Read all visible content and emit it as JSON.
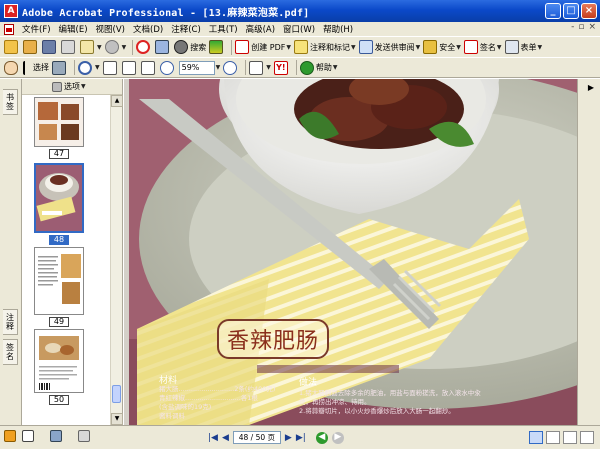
{
  "window": {
    "title": "Adobe Acrobat Professional - [13.麻辣菜泡菜.pdf]",
    "app_icon_letter": "A",
    "controls": {
      "minimize": "_",
      "maximize": "□",
      "close": "×"
    }
  },
  "menubar": {
    "items": [
      "文件(F)",
      "编辑(E)",
      "视图(V)",
      "文档(D)",
      "注释(C)",
      "工具(T)",
      "高级(A)",
      "窗口(W)",
      "帮助(H)"
    ],
    "right_controls": [
      "-",
      "▫",
      "×"
    ]
  },
  "toolbar1": {
    "search_label": "搜索",
    "create_pdf": "创建 PDF",
    "comment_markup": "注释和标记",
    "send_review": "发送供审阅",
    "security": "安全",
    "sign": "签名",
    "forms": "表单"
  },
  "toolbar2": {
    "select_label": "选择",
    "zoom_value": "59%",
    "help_label": "帮助"
  },
  "left_tabs": [
    "书签",
    "注释",
    "签名"
  ],
  "thumbnails": {
    "options_label": "选项",
    "pages": [
      {
        "label": "47",
        "selected": false
      },
      {
        "label": "48",
        "selected": true
      },
      {
        "label": "49",
        "selected": false
      },
      {
        "label": "50",
        "selected": false
      }
    ]
  },
  "document": {
    "dish_title": "香辣肥肠",
    "ingredients_heading": "材料",
    "method_heading": "做法",
    "ingredients_lines": [
      "猪大肠...........................2条(约400克)",
      "青红辣椒...........................各1根",
      "(含盐调味的19克)",
      "酱料调料"
    ],
    "method_lines": [
      "1.猪大肠翻面去除多余的肥油，用盐与面粉搓洗，放入滚水中汆",
      "烫，再捞出冲凉、待用。",
      "2.将蒜瓣切片，以小火炒香爆炒后放入大肠一起翻炒。"
    ]
  },
  "statusbar": {
    "page_field": "48 / 50 页",
    "first": "|◀",
    "prev": "◀",
    "next": "▶",
    "last": "▶|",
    "back": "◀",
    "forward": "▶"
  }
}
